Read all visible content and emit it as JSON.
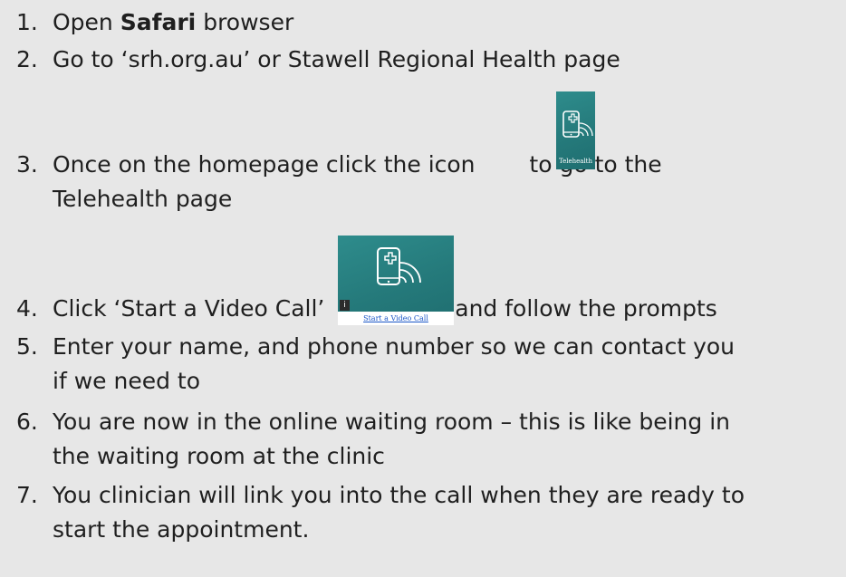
{
  "steps": [
    {
      "number": "1.",
      "text_before": "Open ",
      "bold": "Safari",
      "text_after": " browser"
    },
    {
      "number": "2.",
      "text": "Go to ‘srh.org.au’ or Stawell Regional Health page"
    },
    {
      "number": "3.",
      "text_before": "Once on the homepage click the icon ",
      "text_after": " to go to the",
      "continuation": "Telehealth page"
    },
    {
      "number": "4.",
      "text_before": "Click ‘Start a Video Call’ ",
      "text_after": " and follow the prompts"
    },
    {
      "number": "5.",
      "text": "Enter your name, and phone number so we can contact you",
      "continuation": "if we need to"
    },
    {
      "number": "6.",
      "text": "You are now in the online waiting room – this is like being in",
      "continuation": "the waiting room at the clinic"
    },
    {
      "number": "7.",
      "text": "You clinician will link you into the call when they are ready to",
      "continuation": "start the appointment."
    }
  ],
  "icons": {
    "telehealth": {
      "name": "telehealth-icon",
      "caption": "Telehealth",
      "color": "#2a8383"
    },
    "start_video_call": {
      "name": "start-video-call-icon",
      "link_text": "Start a Video Call",
      "badge": "i",
      "color": "#2a8383",
      "link_color": "#1a56c8"
    }
  },
  "colors": {
    "background": "#e7e7e7",
    "text": "#1f1f1f"
  }
}
